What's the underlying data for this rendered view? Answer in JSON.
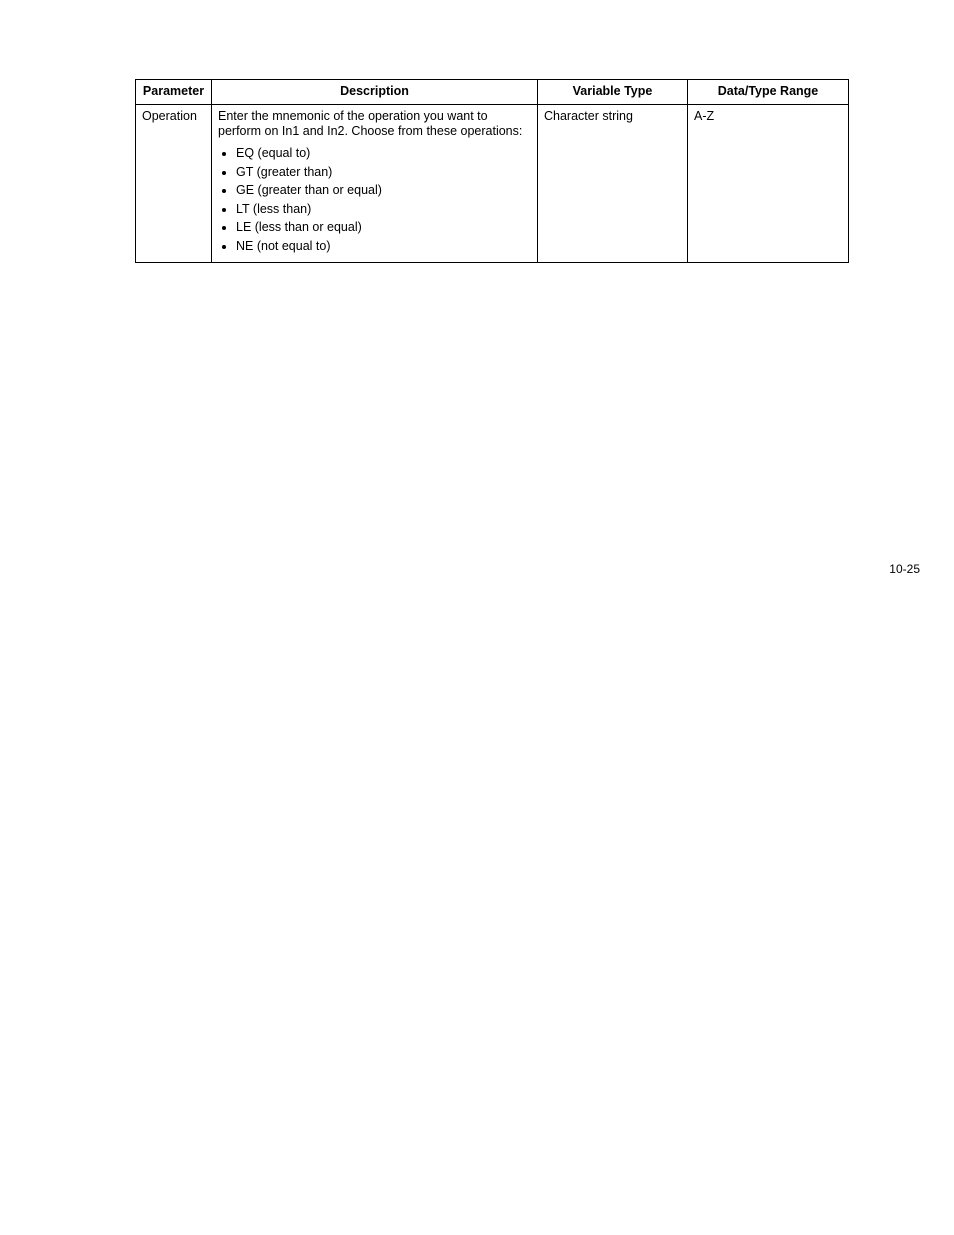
{
  "table": {
    "headers": {
      "parameter": "Parameter",
      "description": "Description",
      "variable_type": "Variable Type",
      "range": "Data/Type Range"
    },
    "row": {
      "parameter": "Operation",
      "description_intro": "Enter the mnemonic of the operation you want to perform on In1 and In2.  Choose from these operations:",
      "ops": [
        "EQ (equal to)",
        "GT (greater than)",
        "GE (greater than or equal)",
        "LT (less than)",
        "LE (less than or equal)",
        "NE (not equal to)"
      ],
      "variable_type": "Character string",
      "range": "A-Z"
    }
  },
  "page_number": "10-25"
}
